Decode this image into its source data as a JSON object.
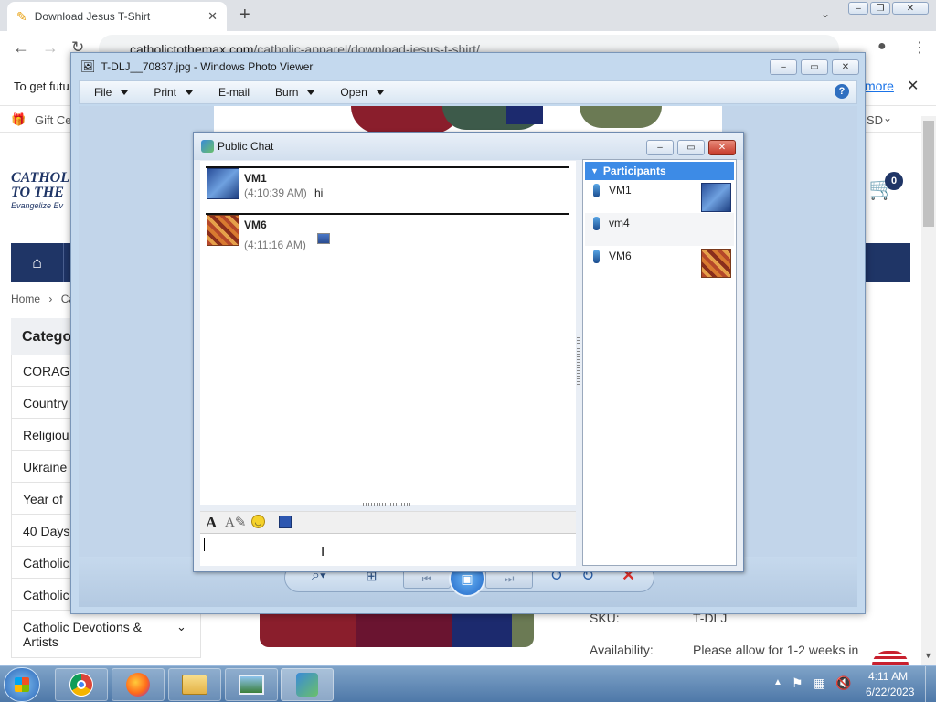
{
  "browser": {
    "tab_title": "Download Jesus T-Shirt",
    "url_domain": "catholictothemax.com",
    "url_path": "/catholic-apparel/download-jesus-t-shirt/",
    "infobar_text": "To get futu",
    "infobar_link": "more"
  },
  "site": {
    "gift_text": "Gift Ce",
    "currency": "SD",
    "logo_line1": "CATHOL",
    "logo_line2": "TO THE",
    "logo_tagline": "Evangelize Ev",
    "cart_count": "0",
    "breadcrumb_home": "Home",
    "breadcrumb_next": "Ca",
    "sidebar_title": "Catego",
    "categories": [
      "CORAGO",
      "Country",
      "Religiou",
      "Ukraine",
      "Year of",
      "40 Days",
      "Catholic",
      "Catholic"
    ],
    "category_last_line1": "Catholic Devotions &",
    "category_last_line2": "Artists",
    "sku_label": "SKU:",
    "sku_value": "T-DLJ",
    "availability_label": "Availability:",
    "availability_value": "Please allow for 1-2 weeks in"
  },
  "photo_viewer": {
    "title": "T-DLJ__70837.jpg - Windows Photo Viewer",
    "menu": [
      "File",
      "Print",
      "E-mail",
      "Burn",
      "Open"
    ],
    "menu_has_dropdown": [
      true,
      true,
      false,
      true,
      true
    ]
  },
  "chat": {
    "title": "Public Chat",
    "messages": [
      {
        "user": "VM1",
        "time": "(4:10:39 AM)",
        "text": "hi"
      },
      {
        "user": "VM6",
        "time": "(4:11:16 AM)",
        "text": ""
      }
    ],
    "participants_label": "Participants",
    "participants": [
      "VM1",
      "vm4",
      "VM6"
    ]
  },
  "taskbar": {
    "time": "4:11 AM",
    "date": "6/22/2023"
  },
  "colors": {
    "nav": "#1f3566",
    "participants_header": "#3d8be6",
    "close_red": "#d9302c"
  }
}
